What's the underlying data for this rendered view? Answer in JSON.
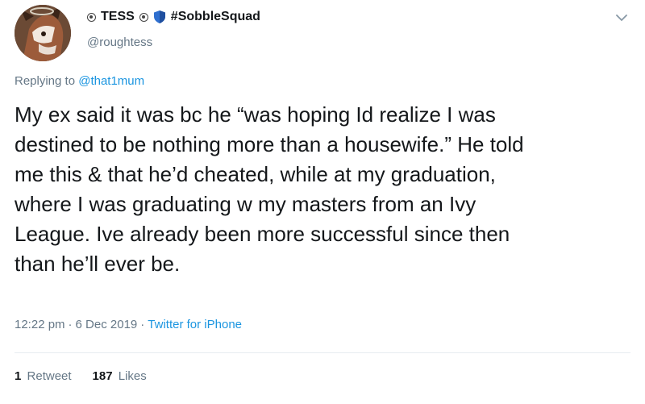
{
  "author": {
    "display_name": "TESS",
    "name_suffix": "#SobbleSquad",
    "handle": "@roughtess"
  },
  "reply": {
    "prefix": "Replying to",
    "mention": "@that1mum"
  },
  "tweet": {
    "text": "My ex said it was bc he “was hoping Id realize I was\ndestined to be nothing more than a housewife.” He told\nme this & that he’d cheated, while at my graduation,\nwhere I was graduating w my masters from an Ivy\nLeague. Ive already been more successful since then\nthan he’ll ever be.",
    "time": "12:22 pm",
    "separator": "·",
    "date": "6 Dec 2019",
    "source": "Twitter for iPhone"
  },
  "stats": {
    "retweets_count": "1",
    "retweets_label": "Retweet",
    "likes_count": "187",
    "likes_label": "Likes"
  },
  "colors": {
    "link": "#1b95e0",
    "secondary_text": "#657786",
    "primary_text": "#14171a",
    "shield_blue": "#2f6fcf"
  },
  "icons": [
    "halo-icon",
    "shield-icon",
    "chevron-down-icon"
  ]
}
